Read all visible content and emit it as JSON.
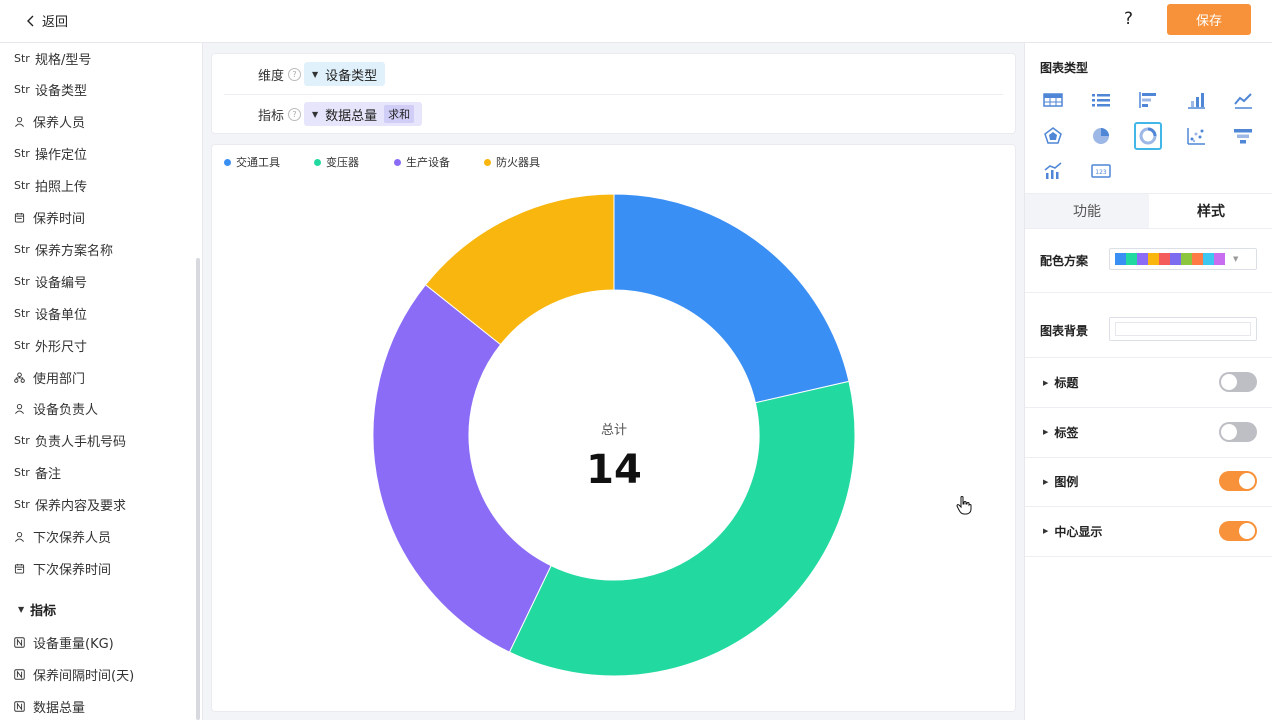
{
  "topbar": {
    "back_label": "返回",
    "help_label": "?",
    "save_label": "保存"
  },
  "fields": [
    {
      "type": "Str",
      "label": "规格/型号"
    },
    {
      "type": "Str",
      "label": "设备类型"
    },
    {
      "type": "user",
      "label": "保养人员"
    },
    {
      "type": "Str",
      "label": "操作定位"
    },
    {
      "type": "Str",
      "label": "拍照上传"
    },
    {
      "type": "date",
      "label": "保养时间"
    },
    {
      "type": "Str",
      "label": "保养方案名称"
    },
    {
      "type": "Str",
      "label": "设备编号"
    },
    {
      "type": "Str",
      "label": "设备单位"
    },
    {
      "type": "Str",
      "label": "外形尺寸"
    },
    {
      "type": "dept",
      "label": "使用部门"
    },
    {
      "type": "user",
      "label": "设备负责人"
    },
    {
      "type": "Str",
      "label": "负责人手机号码"
    },
    {
      "type": "Str",
      "label": "备注"
    },
    {
      "type": "Str",
      "label": "保养内容及要求"
    },
    {
      "type": "user",
      "label": "下次保养人员"
    },
    {
      "type": "date",
      "label": "下次保养时间"
    }
  ],
  "str_tag": "Str",
  "metrics_section": {
    "label": "指标"
  },
  "metric_fields": [
    {
      "type": "N",
      "label": "设备重量(KG)"
    },
    {
      "type": "N",
      "label": "保养间隔时间(天)"
    },
    {
      "type": "N",
      "label": "数据总量"
    }
  ],
  "config": {
    "dimension_label": "维度",
    "dimension_value": "设备类型",
    "metric_label": "指标",
    "metric_value": "数据总量",
    "metric_agg": "求和"
  },
  "chart_data": {
    "type": "pie",
    "variant": "donut",
    "categories": [
      "交通工具",
      "变压器",
      "生产设备",
      "防火器具"
    ],
    "values": [
      3,
      5,
      4,
      2
    ],
    "colors": [
      "#3a8ff5",
      "#22d9a0",
      "#8a6cf7",
      "#f8b60e"
    ],
    "center_label": "总计",
    "center_value": "14",
    "legend": "top-left"
  },
  "right_panel": {
    "chart_type_title": "图表类型",
    "chart_types": [
      "table-icon",
      "detail-table-icon",
      "horizontal-bar-icon",
      "bar-chart-icon",
      "line-chart-icon",
      "radar-chart-icon",
      "pie-chart-icon",
      "donut-chart-icon",
      "scatter-chart-icon",
      "funnel-chart-icon",
      "combo-chart-icon",
      "number-card-icon"
    ],
    "selected_type": "donut-chart-icon",
    "tabs": [
      "功能",
      "样式"
    ],
    "active_tab": "样式",
    "palette_label": "配色方案",
    "palette_colors": [
      "#3a8ff5",
      "#22d9a0",
      "#8a6cf7",
      "#f8b60e",
      "#f45b5b",
      "#7b6cf0",
      "#8cc63f",
      "#ff7a45",
      "#3cc6f0",
      "#c86cf0"
    ],
    "bg_label": "图表背景",
    "options": [
      {
        "label": "标题",
        "on": false
      },
      {
        "label": "标签",
        "on": false
      },
      {
        "label": "图例",
        "on": true
      },
      {
        "label": "中心显示",
        "on": true
      }
    ]
  }
}
